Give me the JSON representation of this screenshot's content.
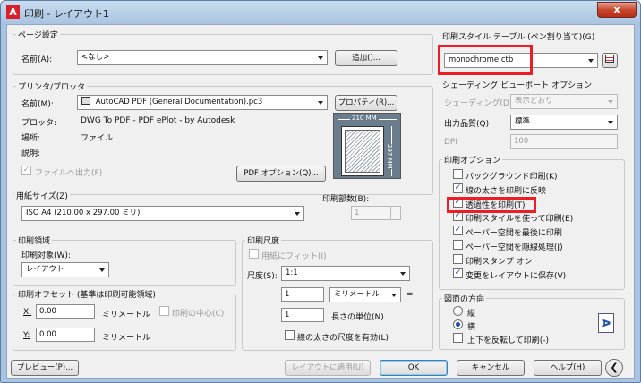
{
  "window": {
    "title": "印刷 - レイアウト1",
    "close_glyph": "x",
    "app_letter": "A"
  },
  "page_setup": {
    "group_title": "ページ設定",
    "name_label": "名前(A):",
    "name_value": "<なし>",
    "add_button": "追加()..."
  },
  "printer": {
    "group_title": "プリンタ/プロッタ",
    "name_label": "名前(M):",
    "name_value": "AutoCAD PDF (General Documentation).pc3",
    "properties_button": "プロパティ(R)...",
    "plotter_label": "プロッタ:",
    "plotter_value": "DWG To PDF - PDF ePlot - by Autodesk",
    "location_label": "場所:",
    "location_value": "ファイル",
    "description_label": "説明:",
    "print_to_file_label": "ファイルへ出力(F)",
    "pdf_options_button": "PDF オプション(Q)...",
    "preview_width": "210 MM",
    "preview_height": "297 MM"
  },
  "paper_size": {
    "group_title": "用紙サイズ(Z)",
    "value": "ISO A4 (210.00 x 297.00 ミリ)",
    "copies_label": "印刷部数(B):",
    "copies_value": "1"
  },
  "plot_area": {
    "group_title": "印刷領域",
    "what_label": "印刷対象(W):",
    "what_value": "レイアウト"
  },
  "plot_scale": {
    "group_title": "印刷尺度",
    "fit_label": "用紙にフィット(I)",
    "scale_label": "尺度(S):",
    "scale_value": "1:1",
    "value1": "1",
    "unit_value": "ミリメートル",
    "equals": "=",
    "value2": "1",
    "unit_label": "長さの単位(N)",
    "lineweight_label": "線の太さの尺度を有効(L)"
  },
  "plot_offset": {
    "group_title": "印刷オフセット (基準は印刷可能領域)",
    "x_label": "X:",
    "x_value": "0.00",
    "x_unit": "ミリメートル",
    "center_label": "印刷の中心(C)",
    "y_label": "Y:",
    "y_value": "0.00",
    "y_unit": "ミリメートル"
  },
  "plot_style": {
    "group_title": "印刷スタイル テーブル (ペン割り当て)(G)",
    "value": "monochrome.ctb"
  },
  "shaded_viewport": {
    "group_title": "シェーディング ビューポート オプション",
    "shade_label": "シェーディング(D)",
    "shade_value": "表示どおり",
    "quality_label": "出力品質(Q)",
    "quality_value": "標準",
    "dpi_label": "DPI",
    "dpi_value": "100"
  },
  "plot_options": {
    "group_title": "印刷オプション",
    "items": [
      {
        "label": "バックグラウンド印刷(K)",
        "checked": false
      },
      {
        "label": "線の太さを印刷に反映",
        "checked": true
      },
      {
        "label": "透過性を印刷(T)",
        "checked": true
      },
      {
        "label": "印刷スタイルを使って印刷(E)",
        "checked": true
      },
      {
        "label": "ペーパー空間を最後に印刷",
        "checked": true
      },
      {
        "label": "ペーパー空間を隠線処理(J)",
        "checked": false
      },
      {
        "label": "印刷スタンプ オン",
        "checked": false
      },
      {
        "label": "変更をレイアウトに保存(V)",
        "checked": true
      }
    ]
  },
  "orientation": {
    "group_title": "図面の方向",
    "portrait_label": "縦",
    "landscape_label": "横",
    "upside_down_label": "上下を反転して印刷(-)",
    "icon_glyph": "A"
  },
  "footer": {
    "preview_button": "プレビュー(P)...",
    "apply_button": "レイアウトに適用(U)",
    "ok_button": "OK",
    "cancel_button": "キャンセル",
    "help_button": "ヘルプ(H)"
  },
  "colors": {
    "highlight": "#ee1c25",
    "title_bar": "#a8c3e0",
    "close": "#c7452d"
  }
}
